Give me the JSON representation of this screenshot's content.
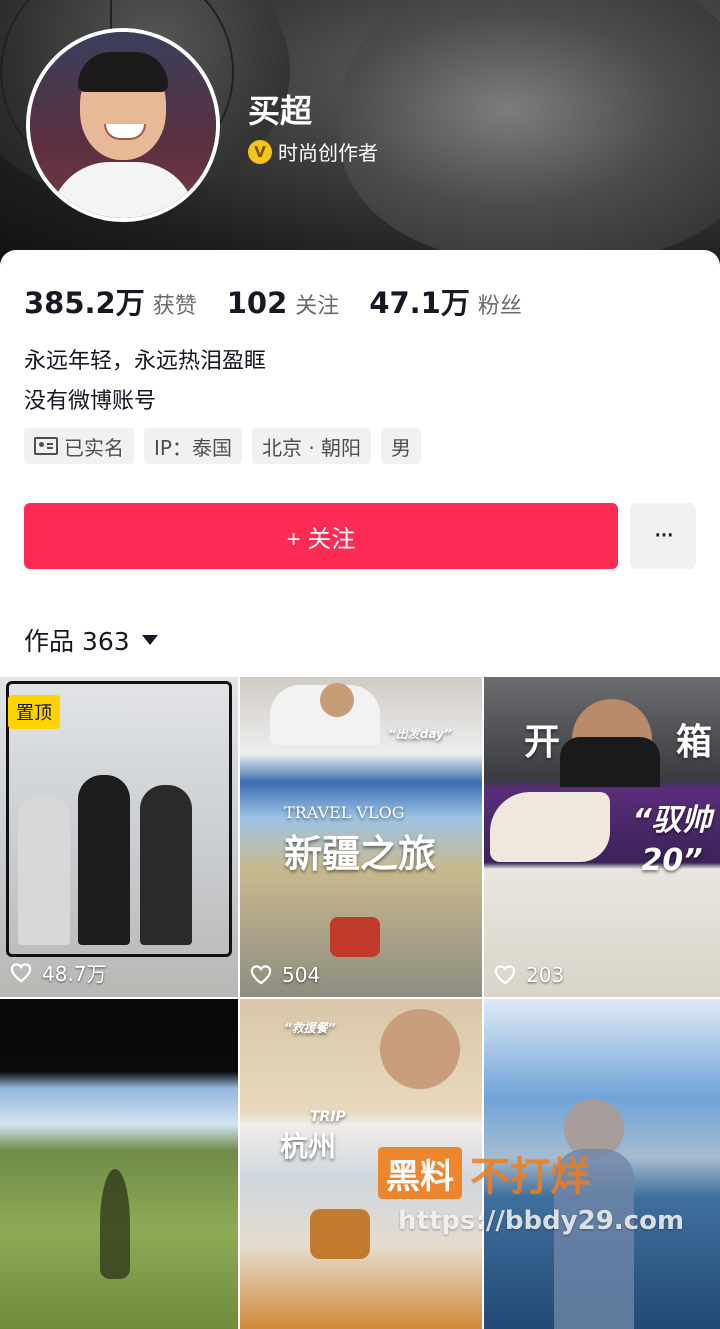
{
  "profile": {
    "name": "买超",
    "verify_badge": "V",
    "verify_label": "时尚创作者",
    "stats": [
      {
        "num": "385.2万",
        "label": "获赞"
      },
      {
        "num": "102",
        "label": "关注"
      },
      {
        "num": "47.1万",
        "label": "粉丝"
      }
    ],
    "bio_lines": [
      "永远年轻，永远热泪盈眶",
      "没有微博账号"
    ],
    "tags": [
      "已实名",
      "IP：泰国",
      "北京 · 朝阳",
      "男"
    ],
    "follow_label": "+ 关注",
    "more_label": "···"
  },
  "works": {
    "label": "作品 363"
  },
  "grid": [
    {
      "likes": "48.7万",
      "pin": "置顶",
      "overlay": ""
    },
    {
      "likes": "504",
      "overlay": "新疆之旅",
      "sub": "TRAVEL VLOG",
      "tag": "“出发day”"
    },
    {
      "likes": "203",
      "overlay": "开",
      "overlay2": "箱",
      "quote": "“驭帅 20”"
    },
    {
      "likes": "",
      "overlay": ""
    },
    {
      "likes": "",
      "overlay": "杭州",
      "sub": "TRIP",
      "tag": "“救援餐”"
    },
    {
      "likes": "",
      "overlay": ""
    }
  ],
  "watermark": {
    "box": "黑料",
    "text": "不打烊",
    "url": "https://bbdy29.com"
  }
}
